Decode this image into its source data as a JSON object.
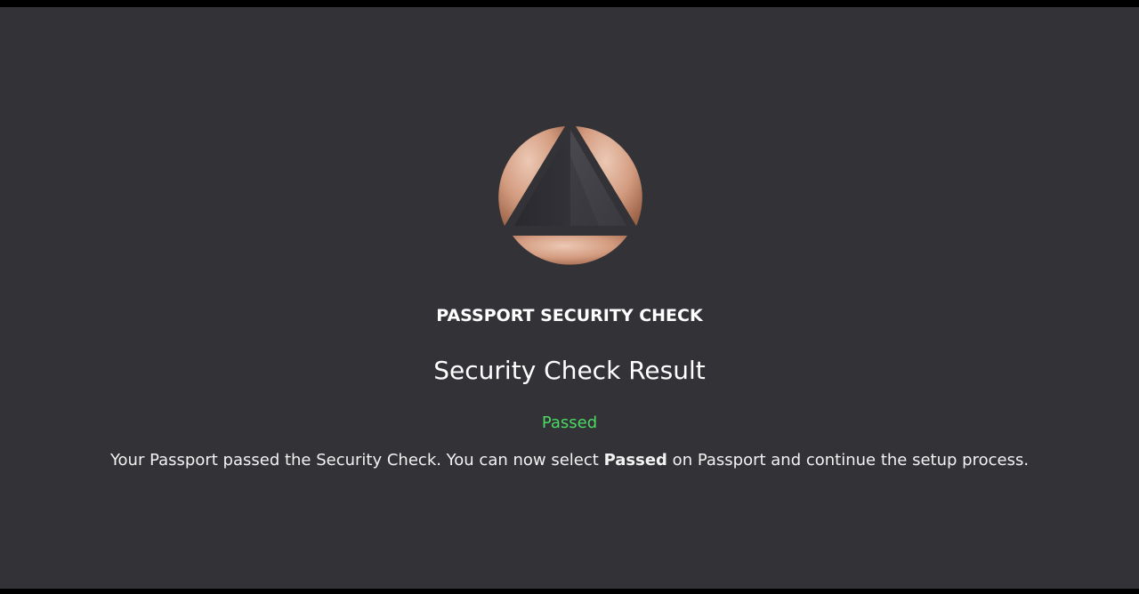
{
  "logo": {
    "icon": "passport-logo-icon",
    "colors": {
      "copper_light": "#e9c2ad",
      "copper_dark": "#a86e52",
      "triangle_dark": "#2b2a2f",
      "triangle_light": "#45444a"
    }
  },
  "header": {
    "app_name": "PASSPORT SECURITY CHECK"
  },
  "result": {
    "title": "Security Check Result",
    "status": "Passed",
    "status_color": "#4cd964",
    "message_part1": "Your Passport passed the Security Check. You can now select ",
    "message_bold": "Passed",
    "message_part2": " on Passport and continue the setup process."
  },
  "colors": {
    "background": "#333237",
    "text": "#ffffff"
  }
}
